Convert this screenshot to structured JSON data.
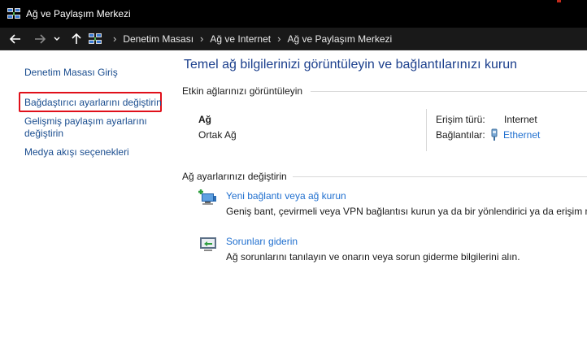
{
  "window": {
    "title": "Ağ ve Paylaşım Merkezi"
  },
  "address": {
    "crumbs": [
      "Denetim Masası",
      "Ağ ve Internet",
      "Ağ ve Paylaşım Merkezi"
    ]
  },
  "sidebar": {
    "items": [
      {
        "label": "Denetim Masası Giriş"
      },
      {
        "label": "Bağdaştırıcı ayarlarını değiştirin"
      },
      {
        "label": "Gelişmiş paylaşım ayarlarını"
      },
      {
        "label": "değiştirin"
      },
      {
        "label": "Medya akışı seçenekleri"
      }
    ]
  },
  "main": {
    "title": "Temel ağ bilgilerinizi görüntüleyin ve bağlantılarınızı kurun",
    "active_networks": {
      "heading": "Etkin ağlarınızı görüntüleyin",
      "network_name": "Ağ",
      "network_category": "Ortak Ağ",
      "access_type_label": "Erişim türü:",
      "access_type_value": "Internet",
      "connections_label": "Bağlantılar:",
      "connection_value": "Ethernet"
    },
    "change_settings": {
      "heading": "Ağ ayarlarınızı değiştirin",
      "tasks": [
        {
          "title": "Yeni bağlantı veya ağ kurun",
          "description": "Geniş bant, çevirmeli veya VPN bağlantısı kurun ya da bir yönlendirici ya da erişim no"
        },
        {
          "title": "Sorunları giderin",
          "description": "Ağ sorunlarını tanılayın ve onarın veya sorun giderme bilgilerini alın."
        }
      ]
    }
  },
  "colors": {
    "link": "#1f6fcf",
    "sidebar_link": "#1a4d8f",
    "title": "#1a3e8c",
    "highlight": "#e0101a"
  }
}
